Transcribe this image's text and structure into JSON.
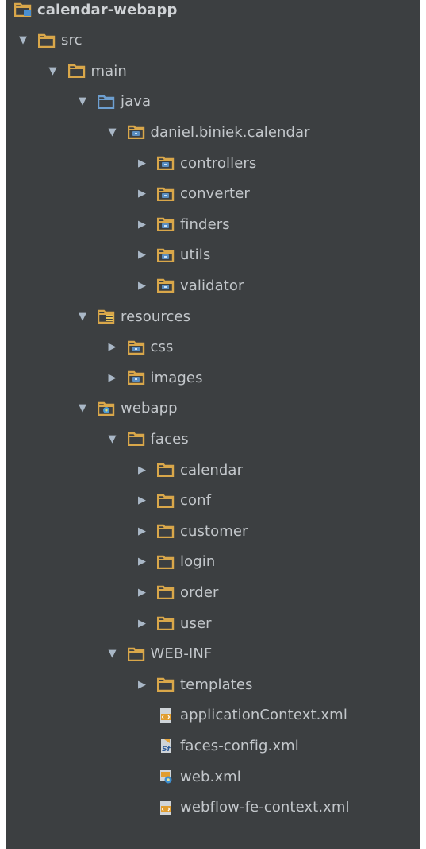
{
  "project_tree": {
    "root": {
      "label": "calendar-webapp",
      "icon": "module-folder-icon"
    },
    "items": [
      {
        "label": "src",
        "depth": 0,
        "expanded": true,
        "icon": "folder-icon"
      },
      {
        "label": "main",
        "depth": 1,
        "expanded": true,
        "icon": "folder-icon"
      },
      {
        "label": "java",
        "depth": 2,
        "expanded": true,
        "icon": "source-root-folder-icon"
      },
      {
        "label": "daniel.biniek.calendar",
        "depth": 3,
        "expanded": true,
        "icon": "package-folder-icon"
      },
      {
        "label": "controllers",
        "depth": 4,
        "expanded": false,
        "icon": "package-folder-icon"
      },
      {
        "label": "converter",
        "depth": 4,
        "expanded": false,
        "icon": "package-folder-icon"
      },
      {
        "label": "finders",
        "depth": 4,
        "expanded": false,
        "icon": "package-folder-icon"
      },
      {
        "label": "utils",
        "depth": 4,
        "expanded": false,
        "icon": "package-folder-icon"
      },
      {
        "label": "validator",
        "depth": 4,
        "expanded": false,
        "icon": "package-folder-icon"
      },
      {
        "label": "resources",
        "depth": 2,
        "expanded": true,
        "icon": "resources-root-folder-icon"
      },
      {
        "label": "css",
        "depth": 3,
        "expanded": false,
        "icon": "package-folder-icon"
      },
      {
        "label": "images",
        "depth": 3,
        "expanded": false,
        "icon": "package-folder-icon"
      },
      {
        "label": "webapp",
        "depth": 2,
        "expanded": true,
        "icon": "web-folder-icon"
      },
      {
        "label": "faces",
        "depth": 3,
        "expanded": true,
        "icon": "folder-icon"
      },
      {
        "label": "calendar",
        "depth": 4,
        "expanded": false,
        "icon": "folder-icon"
      },
      {
        "label": "conf",
        "depth": 4,
        "expanded": false,
        "icon": "folder-icon"
      },
      {
        "label": "customer",
        "depth": 4,
        "expanded": false,
        "icon": "folder-icon"
      },
      {
        "label": "login",
        "depth": 4,
        "expanded": false,
        "icon": "folder-icon"
      },
      {
        "label": "order",
        "depth": 4,
        "expanded": false,
        "icon": "folder-icon"
      },
      {
        "label": "user",
        "depth": 4,
        "expanded": false,
        "icon": "folder-icon"
      },
      {
        "label": "WEB-INF",
        "depth": 3,
        "expanded": true,
        "icon": "folder-icon"
      },
      {
        "label": "templates",
        "depth": 4,
        "expanded": false,
        "icon": "folder-icon"
      },
      {
        "label": "applicationContext.xml",
        "depth": 4,
        "leaf": true,
        "icon": "spring-xml-file-icon"
      },
      {
        "label": "faces-config.xml",
        "depth": 4,
        "leaf": true,
        "icon": "jsf-config-file-icon"
      },
      {
        "label": "web.xml",
        "depth": 4,
        "leaf": true,
        "icon": "web-xml-file-icon"
      },
      {
        "label": "webflow-fe-context.xml",
        "depth": 4,
        "leaf": true,
        "icon": "spring-xml-file-icon"
      }
    ]
  },
  "colors": {
    "background": "#3c3f41",
    "text": "#c3c7cb",
    "folder": "#d9a74a",
    "source_root": "#6d9fd0",
    "package_dot": "#5b8ec0"
  }
}
